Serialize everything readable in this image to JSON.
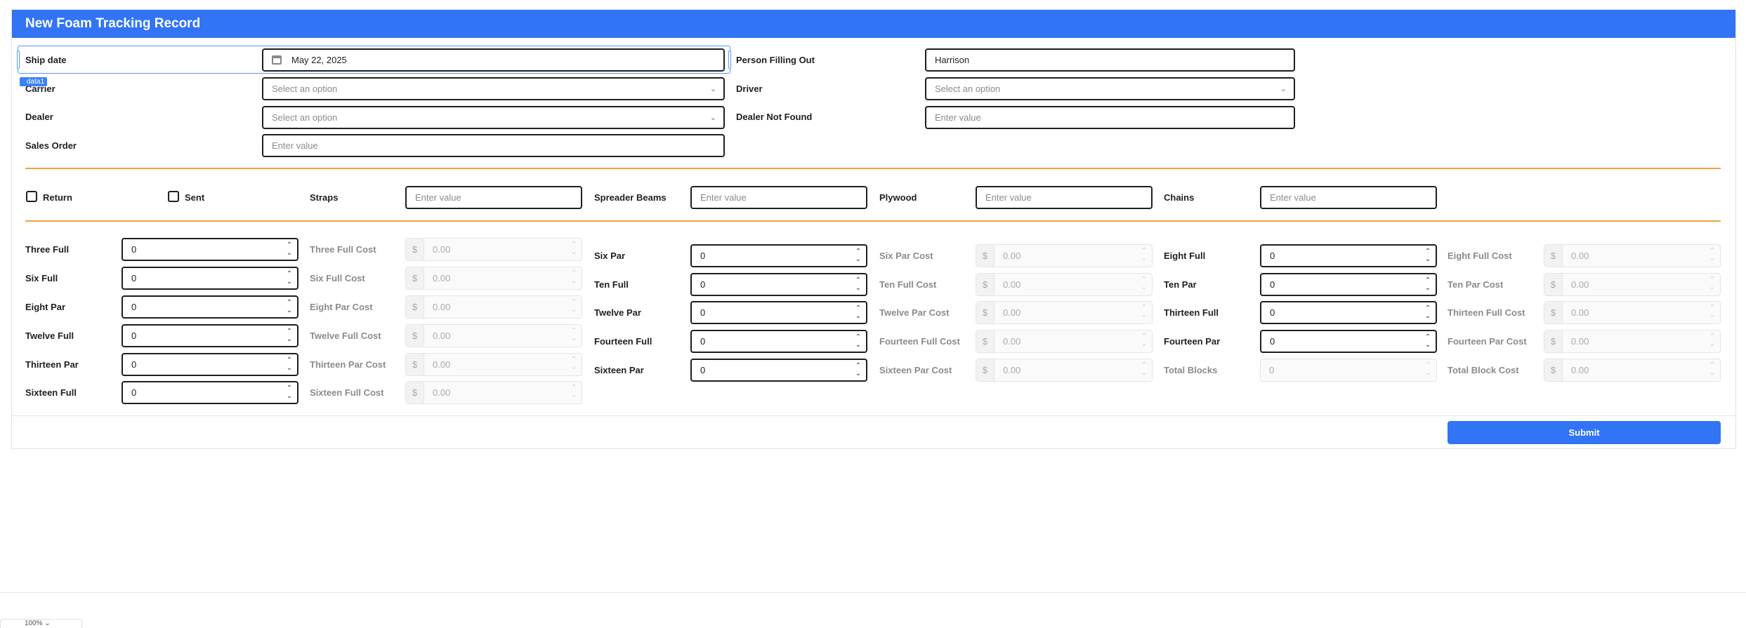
{
  "header": {
    "title": "New Foam Tracking Record"
  },
  "selection": {
    "tag": "data1"
  },
  "top_left": {
    "ship_date": {
      "label": "Ship date",
      "value": "May 22, 2025"
    },
    "carrier": {
      "label": "Carrier",
      "placeholder": "Select an option"
    },
    "dealer": {
      "label": "Dealer",
      "placeholder": "Select an option"
    },
    "sales_order": {
      "label": "Sales Order",
      "placeholder": "Enter value"
    }
  },
  "top_right": {
    "person": {
      "label": "Person Filling Out",
      "value": "Harrison"
    },
    "driver": {
      "label": "Driver",
      "placeholder": "Select an option"
    },
    "dealer_not_found": {
      "label": "Dealer Not Found",
      "placeholder": "Enter value"
    }
  },
  "middle": {
    "return_label": "Return",
    "sent_label": "Sent",
    "straps": {
      "label": "Straps",
      "placeholder": "Enter value"
    },
    "spreader": {
      "label": "Spreader Beams",
      "placeholder": "Enter value"
    },
    "plywood": {
      "label": "Plywood",
      "placeholder": "Enter value"
    },
    "chains": {
      "label": "Chains",
      "placeholder": "Enter value"
    }
  },
  "blocks": {
    "group1": [
      {
        "label": "Three Full",
        "value": "0",
        "cost_label": "Three Full Cost",
        "cost": "0.00"
      },
      {
        "label": "Six Full",
        "value": "0",
        "cost_label": "Six Full Cost",
        "cost": "0.00"
      },
      {
        "label": "Eight Par",
        "value": "0",
        "cost_label": "Eight Par Cost",
        "cost": "0.00"
      },
      {
        "label": "Twelve Full",
        "value": "0",
        "cost_label": "Twelve Full Cost",
        "cost": "0.00"
      },
      {
        "label": "Thirteen Par",
        "value": "0",
        "cost_label": "Thirteen Par Cost",
        "cost": "0.00"
      },
      {
        "label": "Sixteen Full",
        "value": "0",
        "cost_label": "Sixteen Full Cost",
        "cost": "0.00"
      }
    ],
    "group2": [
      {
        "label": "Six Par",
        "value": "0",
        "cost_label": "Six Par Cost",
        "cost": "0.00"
      },
      {
        "label": "Ten Full",
        "value": "0",
        "cost_label": "Ten Full Cost",
        "cost": "0.00"
      },
      {
        "label": "Twelve Par",
        "value": "0",
        "cost_label": "Twelve Par Cost",
        "cost": "0.00"
      },
      {
        "label": "Fourteen Full",
        "value": "0",
        "cost_label": "Fourteen Full Cost",
        "cost": "0.00"
      },
      {
        "label": "Sixteen Par",
        "value": "0",
        "cost_label": "Sixteen Par Cost",
        "cost": "0.00"
      }
    ],
    "group3": [
      {
        "label": "Eight Full",
        "value": "0",
        "cost_label": "Eight Full Cost",
        "cost": "0.00"
      },
      {
        "label": "Ten Par",
        "value": "0",
        "cost_label": "Ten Par Cost",
        "cost": "0.00"
      },
      {
        "label": "Thirteen Full",
        "value": "0",
        "cost_label": "Thirteen Full Cost",
        "cost": "0.00"
      },
      {
        "label": "Fourteen Par",
        "value": "0",
        "cost_label": "Fourteen Par Cost",
        "cost": "0.00"
      }
    ],
    "total_blocks": {
      "label": "Total Blocks",
      "value": "0"
    },
    "total_cost": {
      "label": "Total Block Cost",
      "value": "0.00"
    },
    "currency": "$"
  },
  "submit_label": "Submit",
  "zoom": "100%",
  "colors": {
    "accent": "#3174f5",
    "divider": "#f0a33a"
  }
}
